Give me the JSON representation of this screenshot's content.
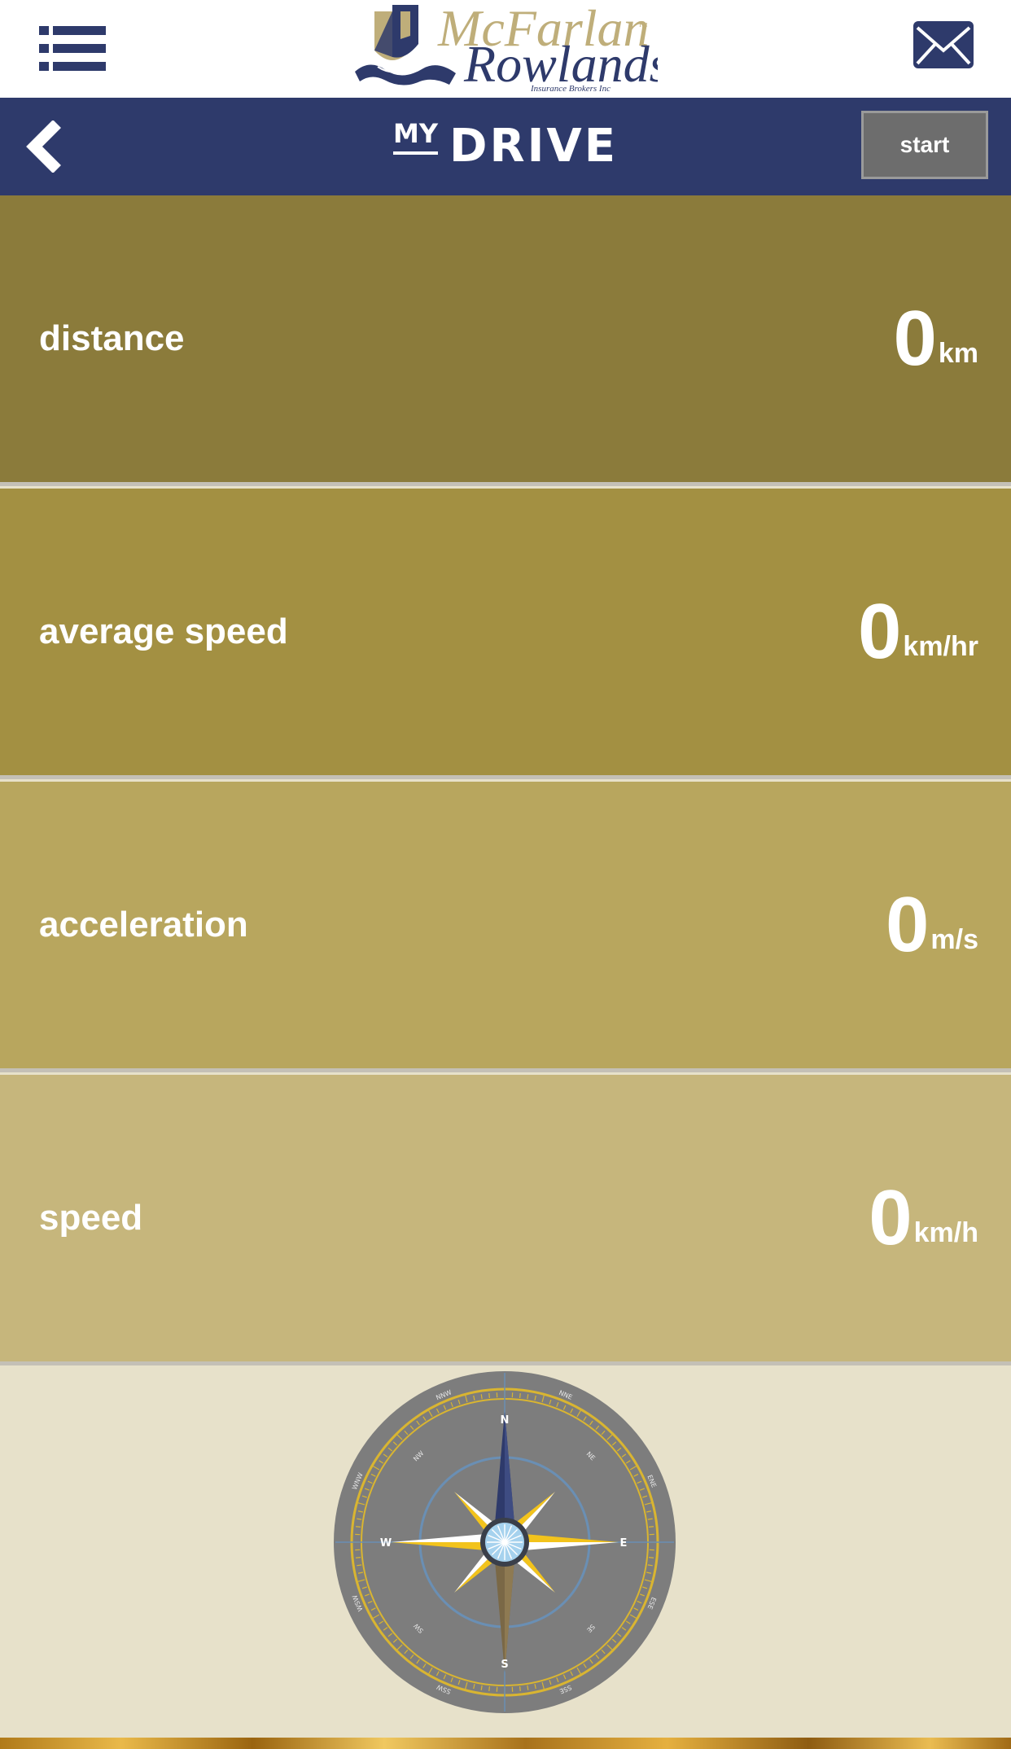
{
  "header": {
    "brand": {
      "line1": "McFarlan",
      "line2": "Rowlands",
      "tagline": "Insurance Brokers Inc",
      "tm": "™"
    },
    "menu_icon": "list-menu-icon",
    "mail_icon": "envelope-icon"
  },
  "nav": {
    "back_icon": "chevron-left-icon",
    "title_small": "MY",
    "title_large": "DRIVE",
    "start_label": "start"
  },
  "stats": [
    {
      "label": "distance",
      "value": "0",
      "unit": "km",
      "color": "#8b7b3b"
    },
    {
      "label": "average speed",
      "value": "0",
      "unit": "km/hr",
      "color": "#a39042"
    },
    {
      "label": "acceleration",
      "value": "0",
      "unit": "m/s",
      "color": "#b8a65e"
    },
    {
      "label": "speed",
      "value": "0",
      "unit": "km/h",
      "color": "#c6b67c"
    }
  ],
  "compass": {
    "north": "N",
    "east": "E",
    "south": "S",
    "west": "W",
    "intercardinals": [
      "NNE",
      "NE",
      "ENE",
      "ESE",
      "SE",
      "SSE",
      "SSW",
      "SW",
      "WSW",
      "WNW",
      "NW",
      "NNW"
    ],
    "icon": "compass-rose-icon"
  },
  "colors": {
    "navbar": "#2e3a6b",
    "brand_navy": "#2e3a6b",
    "brand_gold": "#bfae7a",
    "page_bg": "#e7e1ca",
    "start_button": "#6d6d6d"
  }
}
